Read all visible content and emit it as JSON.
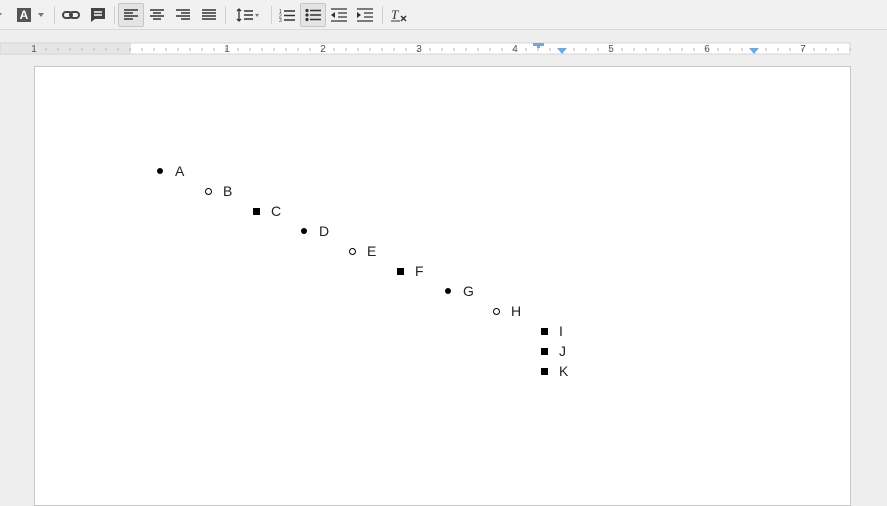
{
  "toolbar": {
    "buttons": [
      "text-color",
      "highlight-color",
      "insert-link",
      "insert-comment",
      "align-left",
      "align-center",
      "align-right",
      "justify",
      "line-spacing",
      "numbered-list",
      "bulleted-list",
      "decrease-indent",
      "increase-indent",
      "clear-formatting"
    ],
    "highlight_glyph": "A"
  },
  "ruler": {
    "labels": [
      "1",
      "1",
      "2",
      "3",
      "4",
      "5",
      "6",
      "7"
    ]
  },
  "document": {
    "items": [
      {
        "label": "A",
        "bullet": "disc"
      },
      {
        "label": "B",
        "bullet": "circle"
      },
      {
        "label": "C",
        "bullet": "square"
      },
      {
        "label": "D",
        "bullet": "disc"
      },
      {
        "label": "E",
        "bullet": "circle"
      },
      {
        "label": "F",
        "bullet": "square"
      },
      {
        "label": "G",
        "bullet": "disc"
      },
      {
        "label": "H",
        "bullet": "circle"
      },
      {
        "label": "I",
        "bullet": "square"
      },
      {
        "label": "J",
        "bullet": "square"
      },
      {
        "label": "K",
        "bullet": "square"
      }
    ]
  },
  "colors": {
    "accent": "#6fa8dc",
    "toolbar_bg": "#f1f1f1",
    "canvas_bg": "#eeeeee"
  }
}
